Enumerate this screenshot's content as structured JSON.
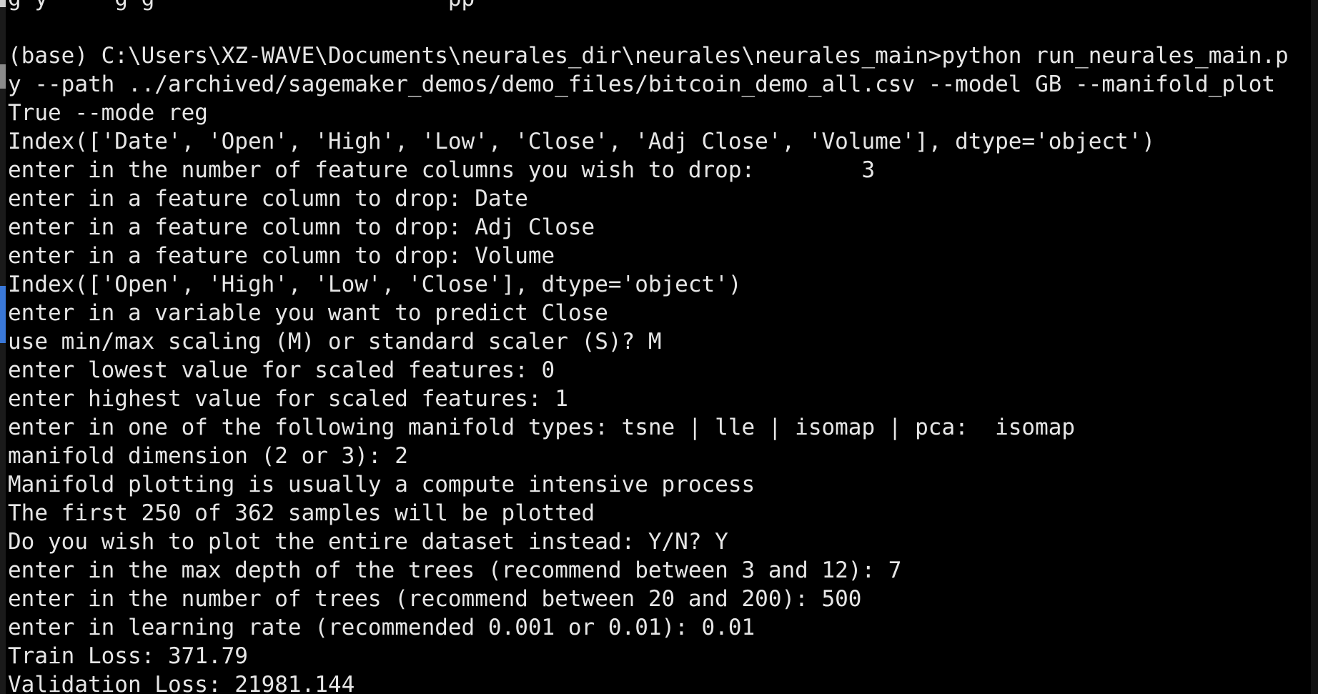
{
  "terminal": {
    "lines": [
      "g y     g g                      pp",
      "",
      "(base) C:\\Users\\XZ-WAVE\\Documents\\neurales_dir\\neurales\\neurales_main>python run_neurales_main.p",
      "y --path ../archived/sagemaker_demos/demo_files/bitcoin_demo_all.csv --model GB --manifold_plot",
      "True --mode reg",
      "Index(['Date', 'Open', 'High', 'Low', 'Close', 'Adj Close', 'Volume'], dtype='object')",
      "enter in the number of feature columns you wish to drop:        3",
      "enter in a feature column to drop: Date",
      "enter in a feature column to drop: Adj Close",
      "enter in a feature column to drop: Volume",
      "Index(['Open', 'High', 'Low', 'Close'], dtype='object')",
      "enter in a variable you want to predict Close",
      "use min/max scaling (M) or standard scaler (S)? M",
      "enter lowest value for scaled features: 0",
      "enter highest value for scaled features: 1",
      "enter in one of the following manifold types: tsne | lle | isomap | pca:  isomap",
      "manifold dimension (2 or 3): 2",
      "Manifold plotting is usually a compute intensive process",
      "The first 250 of 362 samples will be plotted",
      "Do you wish to plot the entire dataset instead: Y/N? Y",
      "enter in the max depth of the trees (recommend between 3 and 12): 7",
      "enter in the number of trees (recommend between 20 and 200): 500",
      "enter in learning rate (recommended 0.001 or 0.01): 0.01",
      "Train Loss: 371.79",
      "Validation Loss: 21981.144"
    ],
    "colors": {
      "background": "#000000",
      "foreground": "#e6e6e6"
    }
  }
}
